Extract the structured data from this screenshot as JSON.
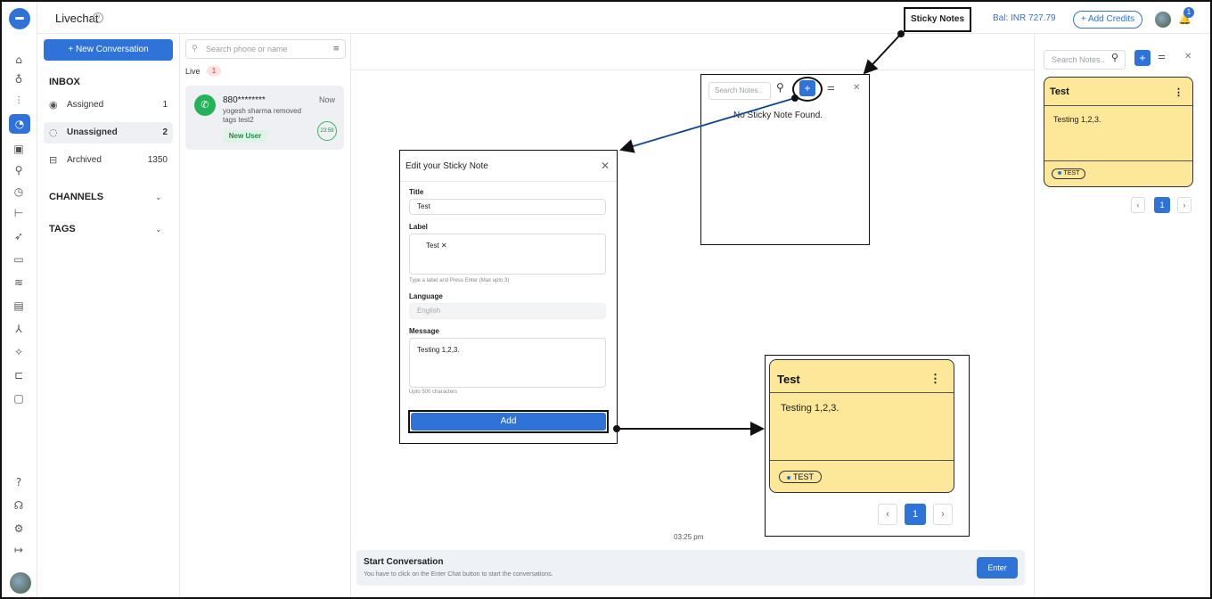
{
  "header": {
    "title": "Livechat",
    "help_icon": "?",
    "sticky_notes_label": "Sticky Notes",
    "balance": "Bal: INR 727.79",
    "add_credits": "+ Add Credits",
    "notification_count": "1"
  },
  "rail": {
    "icons": [
      "home-icon",
      "workflow-icon",
      "analytics-icon",
      "livechat-icon",
      "contacts-icon",
      "integration-icon",
      "history-icon",
      "flow-icon",
      "rocket-icon",
      "folder-icon",
      "automation-icon",
      "ticket-icon",
      "network-icon",
      "sparkle-icon",
      "cart-icon",
      "window-icon",
      "help-icon",
      "agent-icon",
      "settings-icon",
      "logout-icon"
    ]
  },
  "inbox": {
    "new_conversation": "+ New Conversation",
    "section_inbox": "INBOX",
    "items": [
      {
        "label": "Assigned",
        "count": "1",
        "icon": "assigned-icon"
      },
      {
        "label": "Unassigned",
        "count": "2",
        "icon": "unassigned-icon"
      },
      {
        "label": "Archived",
        "count": "1350",
        "icon": "archived-icon"
      }
    ],
    "section_channels": "CHANNELS",
    "section_tags": "TAGS"
  },
  "conversations": {
    "search_placeholder": "Search phone or name",
    "live_label": "Live",
    "live_count": "1",
    "card": {
      "name": "880********",
      "time": "Now",
      "line1": "yogesh sharma removed",
      "line2": "tags test2",
      "tag": "New User",
      "timer": "23:59"
    }
  },
  "chat": {
    "timestamp": "03:25 pm",
    "start_title": "Start Conversation",
    "start_subtitle": "You have to click on the Enter Chat button to start the conversations.",
    "enter_label": "Enter"
  },
  "notes_panel": {
    "search_placeholder": "Search Notes..",
    "note": {
      "title": "Test",
      "message": "Testing 1,2,3.",
      "tag": "TEST"
    },
    "page": "1"
  },
  "popup": {
    "search_placeholder": "Search Notes..",
    "empty_text": "No Sticky Note Found."
  },
  "modal": {
    "title": "Edit your Sticky Note",
    "title_label": "Title",
    "title_value": "Test",
    "label_label": "Label",
    "label_chip": "Test",
    "label_hint": "Type a label and Press Enter (Max upto 3)",
    "language_label": "Language",
    "language_value": "English",
    "message_label": "Message",
    "message_value": "Testing 1,2,3.",
    "message_hint": "Upto 500 characters",
    "add_label": "Add"
  },
  "big_note": {
    "title": "Test",
    "message": "Testing 1,2,3.",
    "tag": "TEST",
    "page": "1"
  },
  "colors": {
    "accent": "#2f73d8",
    "note_bg": "#fde89a",
    "whatsapp": "#25b35a"
  }
}
